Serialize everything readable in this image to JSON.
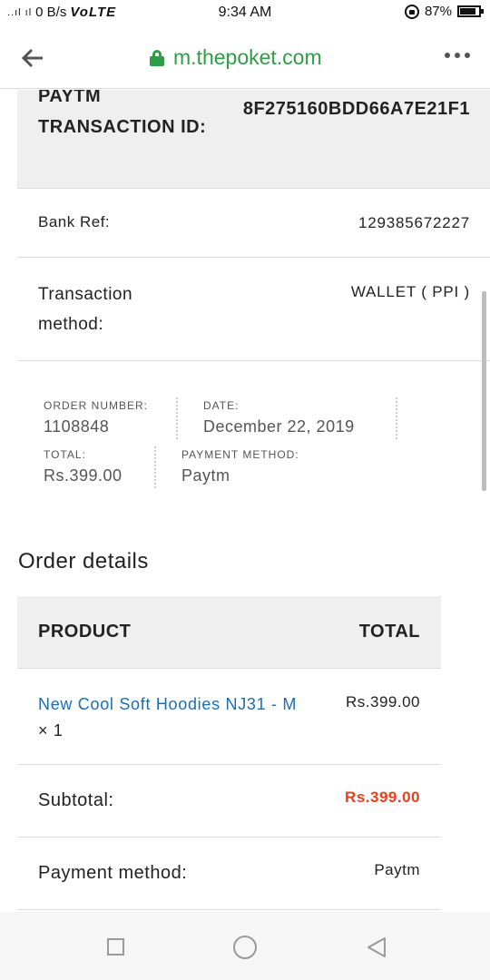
{
  "status_bar": {
    "signal": "..ıl ıl",
    "speed": "0 B/s",
    "network": "VoLTE",
    "time": "9:34 AM",
    "battery": "87%",
    "battery_level": 0.87
  },
  "browser": {
    "url": "m.thepoket.com"
  },
  "transaction": {
    "id_label": "PAYTM TRANSACTION ID:",
    "id_value": "8F275160BDD66A7E21F1",
    "bank_ref_label": "Bank Ref:",
    "bank_ref_value": "129385672227",
    "method_label": "Transaction method:",
    "method_value": "WALLET ( PPI )"
  },
  "summary": {
    "order_number_label": "ORDER NUMBER:",
    "order_number": "1108848",
    "date_label": "DATE:",
    "date": "December 22, 2019",
    "total_label": "TOTAL:",
    "total": "Rs.399.00",
    "payment_method_label": "PAYMENT METHOD:",
    "payment_method": "Paytm"
  },
  "order_details": {
    "title": "Order details",
    "col_product": "PRODUCT",
    "col_total": "TOTAL",
    "item_name": "New Cool Soft Hoodies NJ31 - M",
    "item_qty": "× 1",
    "item_total": "Rs.399.00",
    "subtotal_label": "Subtotal:",
    "subtotal_value": "Rs.399.00",
    "payment_label": "Payment method:",
    "payment_value": "Paytm"
  },
  "colors": {
    "accent_green": "#2e9d46",
    "link_blue": "#1a6eb5",
    "price_orange": "#e8401c"
  }
}
